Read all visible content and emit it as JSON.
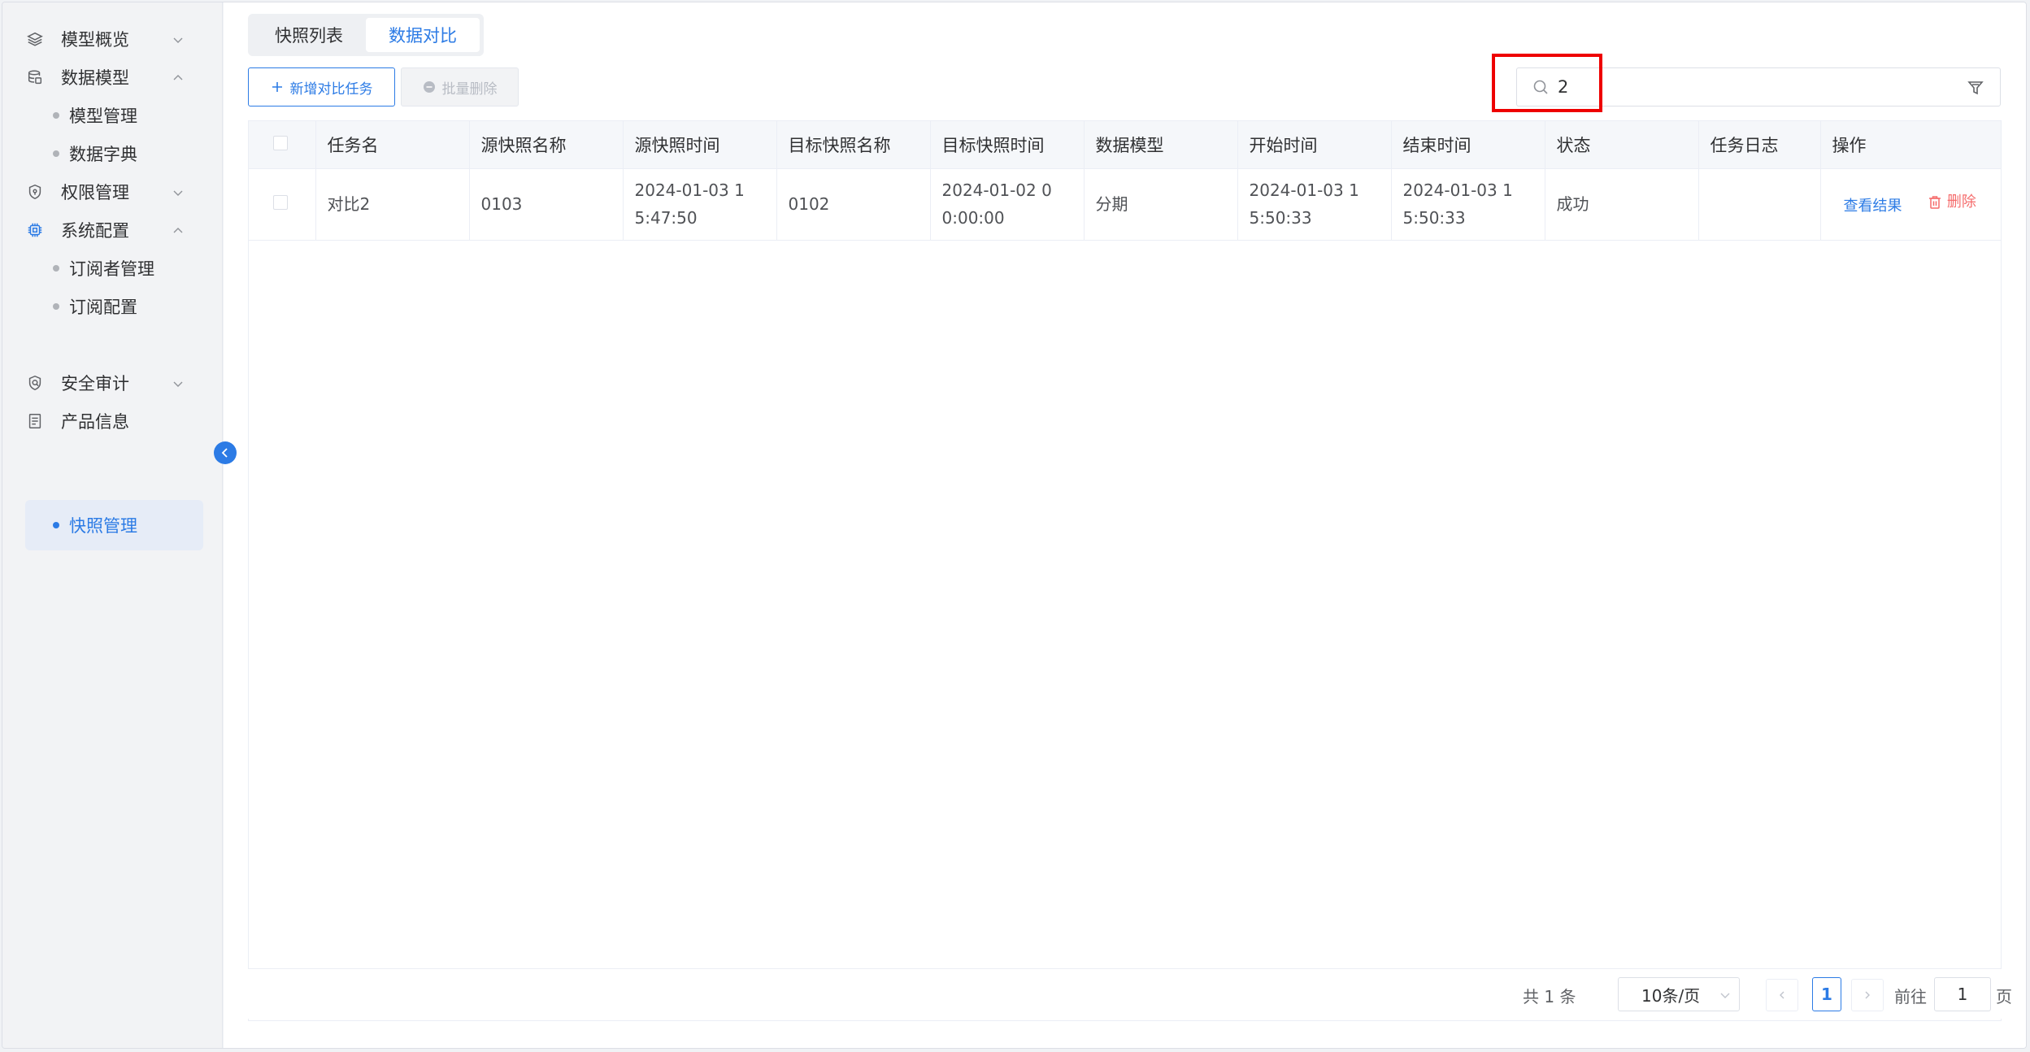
{
  "sidebar": {
    "items": [
      {
        "label": "模型概览",
        "icon": "layers-icon",
        "expanded": false
      },
      {
        "label": "数据模型",
        "icon": "database-icon",
        "expanded": true,
        "children": [
          {
            "label": "模型管理"
          },
          {
            "label": "数据字典"
          }
        ]
      },
      {
        "label": "权限管理",
        "icon": "shield-icon",
        "expanded": false
      },
      {
        "label": "系统配置",
        "icon": "chip-icon",
        "expanded": true,
        "children": [
          {
            "label": "订阅者管理"
          },
          {
            "label": "订阅配置"
          },
          {
            "label": "快照管理",
            "active": true
          }
        ]
      },
      {
        "label": "安全审计",
        "icon": "shield-check-icon",
        "expanded": false
      },
      {
        "label": "产品信息",
        "icon": "document-icon"
      }
    ]
  },
  "tabs": [
    {
      "label": "快照列表",
      "active": false
    },
    {
      "label": "数据对比",
      "active": true
    }
  ],
  "toolbar": {
    "add_label": "新增对比任务",
    "batch_delete_label": "批量删除"
  },
  "search": {
    "value": "2",
    "placeholder": ""
  },
  "table": {
    "headers": [
      "任务名",
      "源快照名称",
      "源快照时间",
      "目标快照名称",
      "目标快照时间",
      "数据模型",
      "开始时间",
      "结束时间",
      "状态",
      "任务日志",
      "操作"
    ],
    "rows": [
      {
        "task_name": "对比2",
        "source_snapshot": "0103",
        "source_time_1": "2024-01-03 1",
        "source_time_2": "5:47:50",
        "target_snapshot": "0102",
        "target_time_1": "2024-01-02 0",
        "target_time_2": "0:00:00",
        "model": "分期",
        "start_1": "2024-01-03 1",
        "start_2": "5:50:33",
        "end_1": "2024-01-03 1",
        "end_2": "5:50:33",
        "status": "成功",
        "log": "",
        "view_label": "查看结果",
        "delete_label": "删除"
      }
    ]
  },
  "pagination": {
    "total": "共 1 条",
    "page_size": "10条/页",
    "current": "1",
    "goto_label": "前往",
    "goto_value": "1",
    "page_suffix": "页"
  },
  "colors": {
    "accent": "#2c7be5",
    "danger": "#f56c6c",
    "highlight": "#ee0000"
  }
}
